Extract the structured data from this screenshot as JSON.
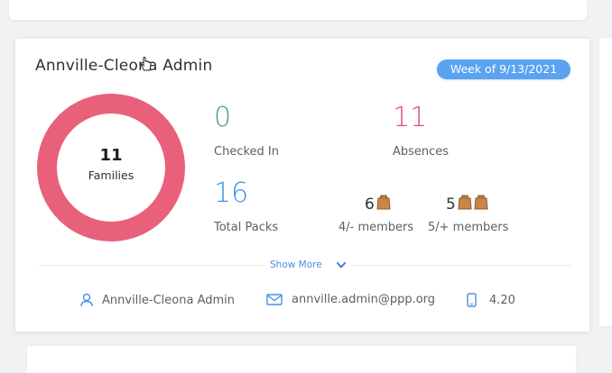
{
  "card": {
    "title": "Annville-Cleona Admin",
    "week": "Week of 9/13/2021"
  },
  "families": {
    "count": "11",
    "label": "Families",
    "ring_color": "#e8607a"
  },
  "stats": {
    "checked_in": {
      "value": "0",
      "label": "Checked In",
      "color": "#4fa37b"
    },
    "absences": {
      "value": "11",
      "label": "Absences",
      "color": "#e0506b"
    },
    "total_packs": {
      "value": "16",
      "label": "Total Packs",
      "color": "#3b8fe8"
    }
  },
  "packs": {
    "small": {
      "count": "6",
      "label": "4/- members",
      "icon": "bag-icon"
    },
    "large": {
      "count": "5",
      "label": "5/+ members",
      "icon": "bag-icon"
    }
  },
  "show_more": {
    "label": "Show More",
    "icon": "chevron-down-icon"
  },
  "footer": {
    "name": {
      "icon": "user-icon",
      "text": "Annville-Cleona Admin"
    },
    "email": {
      "icon": "mail-icon",
      "text": "annville.admin@ppp.org"
    },
    "phone": {
      "icon": "phone-icon",
      "text": "4.20"
    }
  },
  "colors": {
    "accent": "#5aa3f2"
  }
}
